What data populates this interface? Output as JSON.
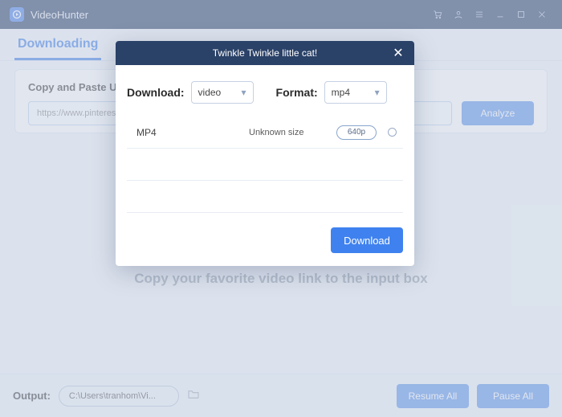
{
  "app": {
    "title": "VideoHunter"
  },
  "tabs": {
    "active": "Downloading"
  },
  "panel": {
    "title": "Copy and Paste URL",
    "url_value": "https://www.pinteres",
    "analyze_label": "Analyze"
  },
  "hint": "Copy your favorite video link to the input box",
  "footer": {
    "output_label": "Output:",
    "path": "C:\\Users\\tranhom\\Vi...",
    "resume_label": "Resume All",
    "pause_label": "Pause All"
  },
  "modal": {
    "title": "Twinkle Twinkle little cat!",
    "download_label": "Download:",
    "download_value": "video",
    "format_label": "Format:",
    "format_value": "mp4",
    "item": {
      "format": "MP4",
      "size": "Unknown size",
      "res": "640p"
    },
    "download_btn": "Download"
  }
}
